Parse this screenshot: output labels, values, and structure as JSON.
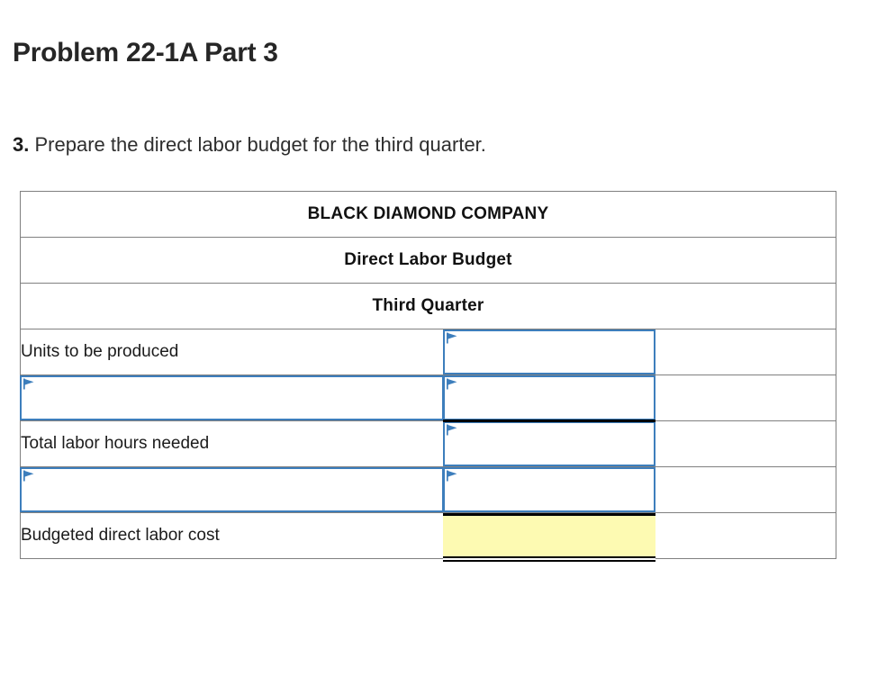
{
  "page": {
    "title": "Problem 22-1A Part 3",
    "instruction_number": "3.",
    "instruction_text": "Prepare the direct labor budget for the third quarter."
  },
  "colors": {
    "header_blue": "#74afe6",
    "input_border_blue": "#3d7ebc",
    "total_yellow": "#fdfab2",
    "grid_gray": "#808080",
    "rule_black": "#000000"
  },
  "worksheet": {
    "header_rows": [
      {
        "text": "BLACK DIAMOND COMPANY"
      },
      {
        "text": "Direct Labor Budget"
      },
      {
        "text": "Third Quarter"
      }
    ],
    "rows": [
      {
        "label": "Units to be produced",
        "label_kind": "text",
        "label_value": "",
        "amount_kind": "input",
        "amount_value": "",
        "amount_placeholder": "",
        "amount_rule": "none"
      },
      {
        "label": "",
        "label_kind": "input",
        "label_value": "",
        "label_placeholder": "",
        "amount_kind": "input",
        "amount_value": "",
        "amount_placeholder": "",
        "amount_rule": "single"
      },
      {
        "label": "Total labor hours needed",
        "label_kind": "text",
        "label_value": "",
        "amount_kind": "input",
        "amount_value": "",
        "amount_placeholder": "",
        "amount_rule": "none"
      },
      {
        "label": "",
        "label_kind": "input",
        "label_value": "",
        "label_placeholder": "",
        "amount_kind": "input",
        "amount_value": "",
        "amount_placeholder": "",
        "amount_rule": "none"
      },
      {
        "label": "Budgeted direct labor cost",
        "label_kind": "text",
        "label_value": "",
        "amount_kind": "total",
        "amount_value": "",
        "amount_placeholder": "",
        "amount_rule": "double"
      }
    ]
  }
}
